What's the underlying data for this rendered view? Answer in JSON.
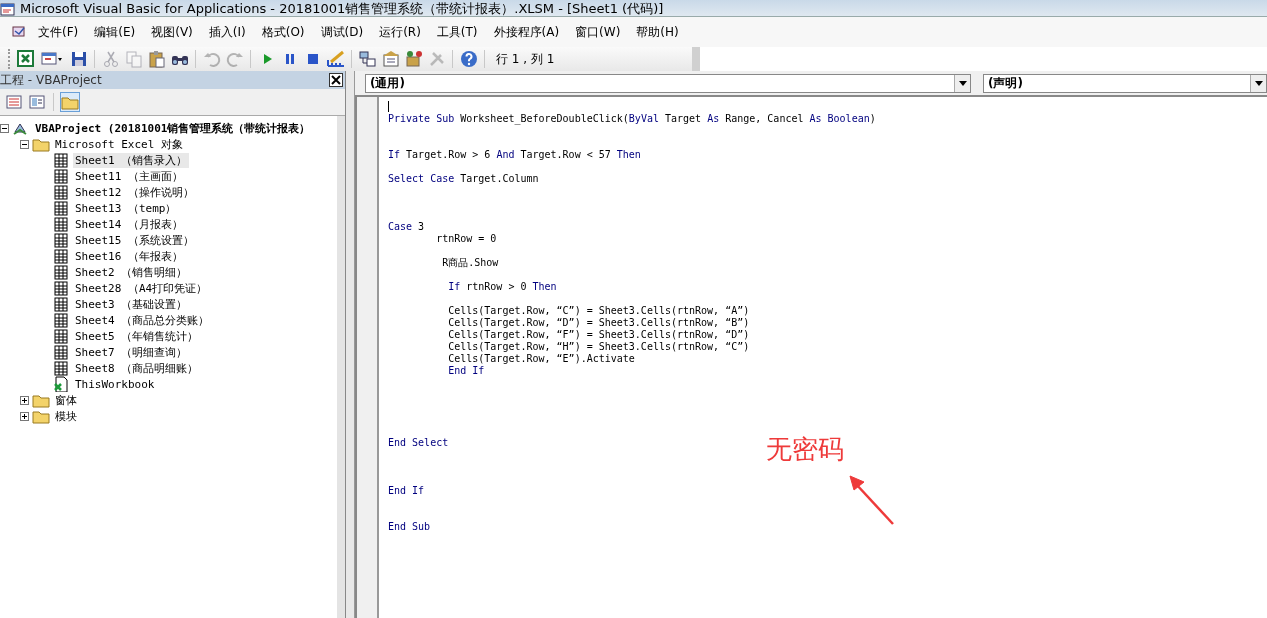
{
  "window": {
    "title": "Microsoft Visual Basic for Applications - 20181001销售管理系统（带统计报表）.XLSM - [Sheet1 (代码)]"
  },
  "menu": [
    "文件(F)",
    "编辑(E)",
    "视图(V)",
    "插入(I)",
    "格式(O)",
    "调试(D)",
    "运行(R)",
    "工具(T)",
    "外接程序(A)",
    "窗口(W)",
    "帮助(H)"
  ],
  "toolbar": [
    {
      "kind": "excel",
      "disabled": false
    },
    {
      "kind": "insert-form",
      "disabled": false
    },
    {
      "kind": "save",
      "disabled": false
    },
    {
      "kind": "sep"
    },
    {
      "kind": "cut",
      "disabled": true
    },
    {
      "kind": "copy",
      "disabled": true
    },
    {
      "kind": "paste",
      "disabled": false
    },
    {
      "kind": "find",
      "disabled": false
    },
    {
      "kind": "sep"
    },
    {
      "kind": "undo",
      "disabled": true
    },
    {
      "kind": "redo",
      "disabled": true
    },
    {
      "kind": "sep"
    },
    {
      "kind": "run",
      "disabled": false
    },
    {
      "kind": "pause",
      "disabled": false
    },
    {
      "kind": "stop",
      "disabled": false
    },
    {
      "kind": "design",
      "disabled": false
    },
    {
      "kind": "sep"
    },
    {
      "kind": "explorer",
      "disabled": false
    },
    {
      "kind": "properties",
      "disabled": false
    },
    {
      "kind": "browser",
      "disabled": false
    },
    {
      "kind": "toolbox",
      "disabled": true
    },
    {
      "kind": "sep"
    },
    {
      "kind": "help",
      "disabled": false
    },
    {
      "kind": "sep"
    }
  ],
  "cursor_position": "行 1 , 列 1",
  "project_pane": {
    "title": "工程 - VBAProject",
    "buttons": [
      {
        "kind": "view-code",
        "pressed": false
      },
      {
        "kind": "view-object",
        "pressed": false
      },
      {
        "kind": "toggle-folders",
        "pressed": true
      }
    ],
    "tree": [
      {
        "label": "VBAProject (20181001销售管理系统（带统计报表）",
        "kind": "project",
        "expanded": true,
        "selected": false,
        "children": [
          {
            "label": "Microsoft Excel 对象",
            "kind": "folder",
            "expanded": true,
            "selected": false,
            "children": [
              {
                "label": "Sheet1 （销售录入）",
                "kind": "sheet",
                "selected": true
              },
              {
                "label": "Sheet11 （主画面）",
                "kind": "sheet",
                "selected": false
              },
              {
                "label": "Sheet12 （操作说明）",
                "kind": "sheet",
                "selected": false
              },
              {
                "label": "Sheet13 （temp）",
                "kind": "sheet",
                "selected": false
              },
              {
                "label": "Sheet14 （月报表）",
                "kind": "sheet",
                "selected": false
              },
              {
                "label": "Sheet15 （系统设置）",
                "kind": "sheet",
                "selected": false
              },
              {
                "label": "Sheet16 （年报表）",
                "kind": "sheet",
                "selected": false
              },
              {
                "label": "Sheet2 （销售明细）",
                "kind": "sheet",
                "selected": false
              },
              {
                "label": "Sheet28 （A4打印凭证）",
                "kind": "sheet",
                "selected": false
              },
              {
                "label": "Sheet3 （基础设置）",
                "kind": "sheet",
                "selected": false
              },
              {
                "label": "Sheet4 （商品总分类账）",
                "kind": "sheet",
                "selected": false
              },
              {
                "label": "Sheet5 （年销售统计）",
                "kind": "sheet",
                "selected": false
              },
              {
                "label": "Sheet7 （明细查询）",
                "kind": "sheet",
                "selected": false
              },
              {
                "label": "Sheet8 （商品明细账）",
                "kind": "sheet",
                "selected": false
              },
              {
                "label": "ThisWorkbook",
                "kind": "workbook",
                "selected": false
              }
            ]
          },
          {
            "label": "窗体",
            "kind": "folder",
            "expanded": false,
            "selected": false
          },
          {
            "label": "模块",
            "kind": "folder",
            "expanded": false,
            "selected": false
          }
        ]
      }
    ]
  },
  "code_window": {
    "object_dropdown": "(通用)",
    "procedure_dropdown": "(声明)",
    "lines": [
      {
        "kind": "cursor"
      },
      {
        "kind": "code",
        "tokens": [
          {
            "text": "Private Sub",
            "kind": "keyword"
          },
          {
            "text": " Worksheet_BeforeDoubleClick(",
            "kind": "plain"
          },
          {
            "text": "ByVal",
            "kind": "keyword"
          },
          {
            "text": " Target ",
            "kind": "plain"
          },
          {
            "text": "As",
            "kind": "keyword"
          },
          {
            "text": " Range, Cancel ",
            "kind": "plain"
          },
          {
            "text": "As Boolean",
            "kind": "keyword"
          },
          {
            "text": ")",
            "kind": "plain"
          }
        ]
      },
      {
        "kind": "blank"
      },
      {
        "kind": "blank"
      },
      {
        "kind": "code",
        "tokens": [
          {
            "text": "If",
            "kind": "keyword"
          },
          {
            "text": " Target.Row > 6 ",
            "kind": "plain"
          },
          {
            "text": "And",
            "kind": "keyword"
          },
          {
            "text": " Target.Row < 57 ",
            "kind": "plain"
          },
          {
            "text": "Then",
            "kind": "keyword"
          }
        ]
      },
      {
        "kind": "blank"
      },
      {
        "kind": "code",
        "tokens": [
          {
            "text": "Select Case",
            "kind": "keyword"
          },
          {
            "text": " Target.Column",
            "kind": "plain"
          }
        ]
      },
      {
        "kind": "blank"
      },
      {
        "kind": "blank"
      },
      {
        "kind": "blank"
      },
      {
        "kind": "code",
        "tokens": [
          {
            "text": "Case",
            "kind": "keyword"
          },
          {
            "text": " 3",
            "kind": "plain"
          }
        ]
      },
      {
        "kind": "code",
        "tokens": [
          {
            "text": "        rtnRow = 0",
            "kind": "plain"
          }
        ]
      },
      {
        "kind": "blank"
      },
      {
        "kind": "code",
        "tokens": [
          {
            "text": "         R商品.Show",
            "kind": "plain"
          }
        ]
      },
      {
        "kind": "blank"
      },
      {
        "kind": "code",
        "tokens": [
          {
            "text": "          If",
            "kind": "keyword"
          },
          {
            "text": " rtnRow > 0 ",
            "kind": "plain"
          },
          {
            "text": "Then",
            "kind": "keyword"
          }
        ]
      },
      {
        "kind": "blank"
      },
      {
        "kind": "code",
        "tokens": [
          {
            "text": "          Cells(Target.Row, “C”) = Sheet3.Cells(rtnRow, “A”)",
            "kind": "plain"
          }
        ]
      },
      {
        "kind": "code",
        "tokens": [
          {
            "text": "          Cells(Target.Row, “D”) = Sheet3.Cells(rtnRow, “B”)",
            "kind": "plain"
          }
        ]
      },
      {
        "kind": "code",
        "tokens": [
          {
            "text": "          Cells(Target.Row, “F”) = Sheet3.Cells(rtnRow, “D”)",
            "kind": "plain"
          }
        ]
      },
      {
        "kind": "code",
        "tokens": [
          {
            "text": "          Cells(Target.Row, “H”) = Sheet3.Cells(rtnRow, “C”)",
            "kind": "plain"
          }
        ]
      },
      {
        "kind": "code",
        "tokens": [
          {
            "text": "          Cells(Target.Row, “E”).Activate",
            "kind": "plain"
          }
        ]
      },
      {
        "kind": "code",
        "tokens": [
          {
            "text": "          End If",
            "kind": "keyword"
          }
        ]
      },
      {
        "kind": "blank"
      },
      {
        "kind": "blank"
      },
      {
        "kind": "blank"
      },
      {
        "kind": "blank"
      },
      {
        "kind": "blank"
      },
      {
        "kind": "code",
        "tokens": [
          {
            "text": "End Select",
            "kind": "keyword"
          }
        ]
      },
      {
        "kind": "blank"
      },
      {
        "kind": "blank"
      },
      {
        "kind": "blank"
      },
      {
        "kind": "code",
        "tokens": [
          {
            "text": "End If",
            "kind": "keyword"
          }
        ]
      },
      {
        "kind": "blank"
      },
      {
        "kind": "blank"
      },
      {
        "kind": "code",
        "tokens": [
          {
            "text": "End Sub",
            "kind": "keyword"
          }
        ]
      }
    ]
  },
  "annotation": {
    "text": "无密码"
  }
}
